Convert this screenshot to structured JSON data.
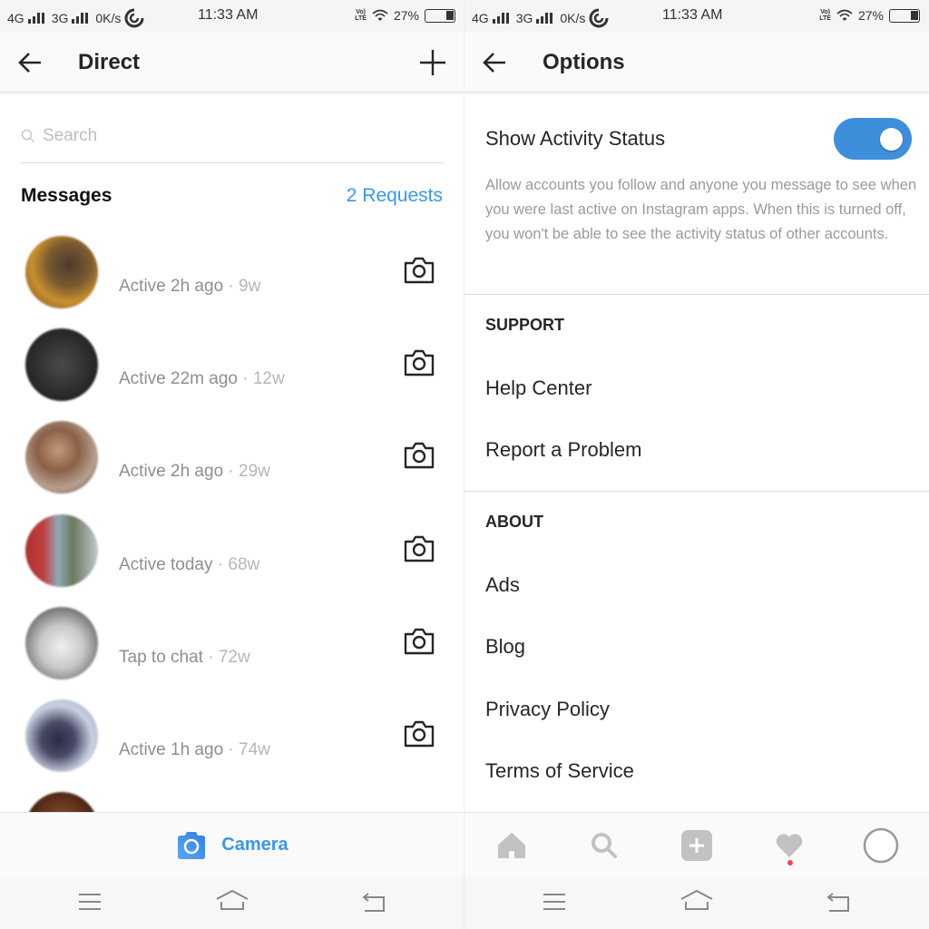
{
  "status_bar": {
    "network1": "4G",
    "network2": "3G",
    "speed": "0K/s",
    "time": "11:33 AM",
    "volte": "Vo) LTE",
    "battery": "27%"
  },
  "left_screen": {
    "header": {
      "title": "Direct",
      "back_icon": "arrow-left-icon",
      "action_icon": "plus-icon"
    },
    "search": {
      "placeholder": "Search",
      "value": ""
    },
    "messages_label": "Messages",
    "requests_link": "2 Requests",
    "threads": [
      {
        "status": "Active 2h ago",
        "age": "· 9w"
      },
      {
        "status": "Active 22m ago",
        "age": "· 12w"
      },
      {
        "status": "Active 2h ago",
        "age": "· 29w"
      },
      {
        "status": "Active today",
        "age": "· 68w"
      },
      {
        "status": "Tap to chat",
        "age": "· 72w"
      },
      {
        "status": "Active 1h ago",
        "age": "· 74w"
      }
    ],
    "camera_button": "Camera"
  },
  "right_screen": {
    "header": {
      "title": "Options",
      "back_icon": "arrow-left-icon"
    },
    "activity_status": {
      "label": "Show Activity Status",
      "enabled": true,
      "description": "Allow accounts you follow and anyone you message to see when you were last active on Instagram apps. When this is turned off, you won't be able to see the activity status of other accounts."
    },
    "sections": [
      {
        "title": "SUPPORT",
        "items": [
          "Help Center",
          "Report a Problem"
        ]
      },
      {
        "title": "ABOUT",
        "items": [
          "Ads",
          "Blog",
          "Privacy Policy",
          "Terms of Service"
        ]
      }
    ],
    "tabbar": [
      "home-icon",
      "search-icon",
      "add-post-icon",
      "heart-icon",
      "profile-icon"
    ]
  },
  "colors": {
    "accent": "#3897f0",
    "toggle_on": "#3d8fdc",
    "notification": "#ed4956",
    "secondary_text": "#8e8e8e"
  }
}
